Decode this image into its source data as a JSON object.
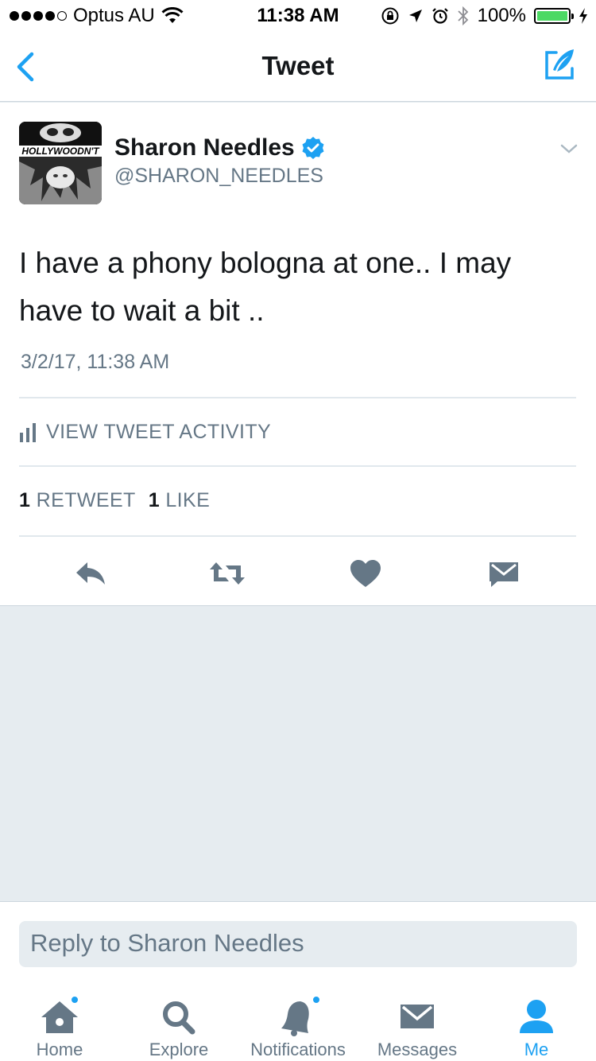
{
  "status_bar": {
    "carrier": "Optus AU",
    "time": "11:38 AM",
    "battery": "100%"
  },
  "nav": {
    "title": "Tweet"
  },
  "tweet": {
    "avatar_text": "HOLLYWOODN'T",
    "name": "Sharon Needles",
    "handle": "@SHARON_NEEDLES",
    "text": "I have a phony bologna at one.. I may have to wait a bit ..",
    "date": "3/2/17, 11:38 AM",
    "activity_label": "VIEW TWEET ACTIVITY",
    "retweet_count": "1",
    "retweet_label": "RETWEET",
    "like_count": "1",
    "like_label": "LIKE"
  },
  "reply": {
    "placeholder": "Reply to Sharon Needles"
  },
  "tabs": [
    {
      "label": "Home",
      "icon": "home-icon"
    },
    {
      "label": "Explore",
      "icon": "search-icon"
    },
    {
      "label": "Notifications",
      "icon": "bell-icon"
    },
    {
      "label": "Messages",
      "icon": "envelope-icon"
    },
    {
      "label": "Me",
      "icon": "person-icon"
    }
  ],
  "colors": {
    "accent": "#1da1f2",
    "secondary_text": "#657786",
    "background": "#e6ecf0",
    "battery": "#4cd964"
  }
}
